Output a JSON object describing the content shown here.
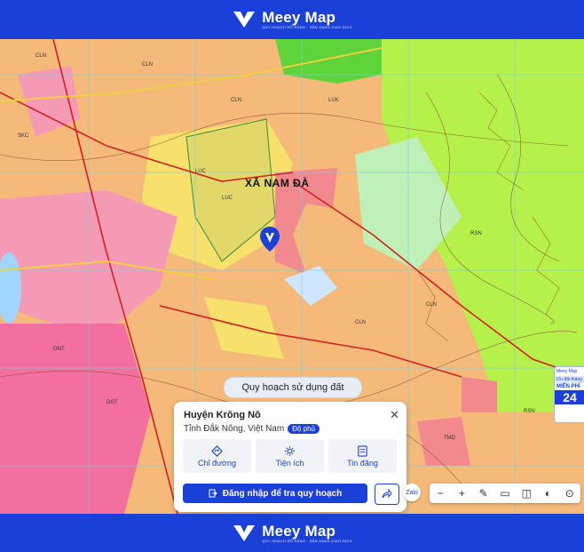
{
  "brand": {
    "name": "Meey Map",
    "tagline": "QUY HOẠCH RÕ RÀNG - SẴN SÀNG GIAO DỊCH"
  },
  "map": {
    "area_label": "XÃ NAM ĐÀ",
    "layer_pill": "Quy hoạch sử dụng đất",
    "zone_labels": [
      "CLN",
      "LUC",
      "LUK",
      "ONT",
      "DGT",
      "RSN",
      "SKC",
      "TMD"
    ]
  },
  "place_card": {
    "title": "Huyện Krông Nô",
    "subtitle": "Tỉnh Đắk Nông, Việt Nam",
    "badge": "Độ phủ",
    "actions": [
      {
        "label": "Chỉ đường",
        "icon": "directions-icon"
      },
      {
        "label": "Tiện ích",
        "icon": "utilities-icon"
      },
      {
        "label": "Tin đăng",
        "icon": "listings-icon"
      }
    ],
    "login_label": "Đăng nhập để tra quy hoạch"
  },
  "toolbar": {
    "items": [
      "−",
      "+",
      "✎",
      "▭",
      "◫",
      "◐",
      "⊙"
    ]
  },
  "zalo_label": "Zalo",
  "promo": {
    "line1": "Meey Map",
    "line2": "Ưu đãi tháng",
    "line3": "MIỄN PHÍ",
    "line4": "24"
  },
  "colors": {
    "brand_blue": "#1b40d8",
    "residential": "#f59ab5",
    "forest": "#b6f04a",
    "agri": "#f7e06b"
  }
}
